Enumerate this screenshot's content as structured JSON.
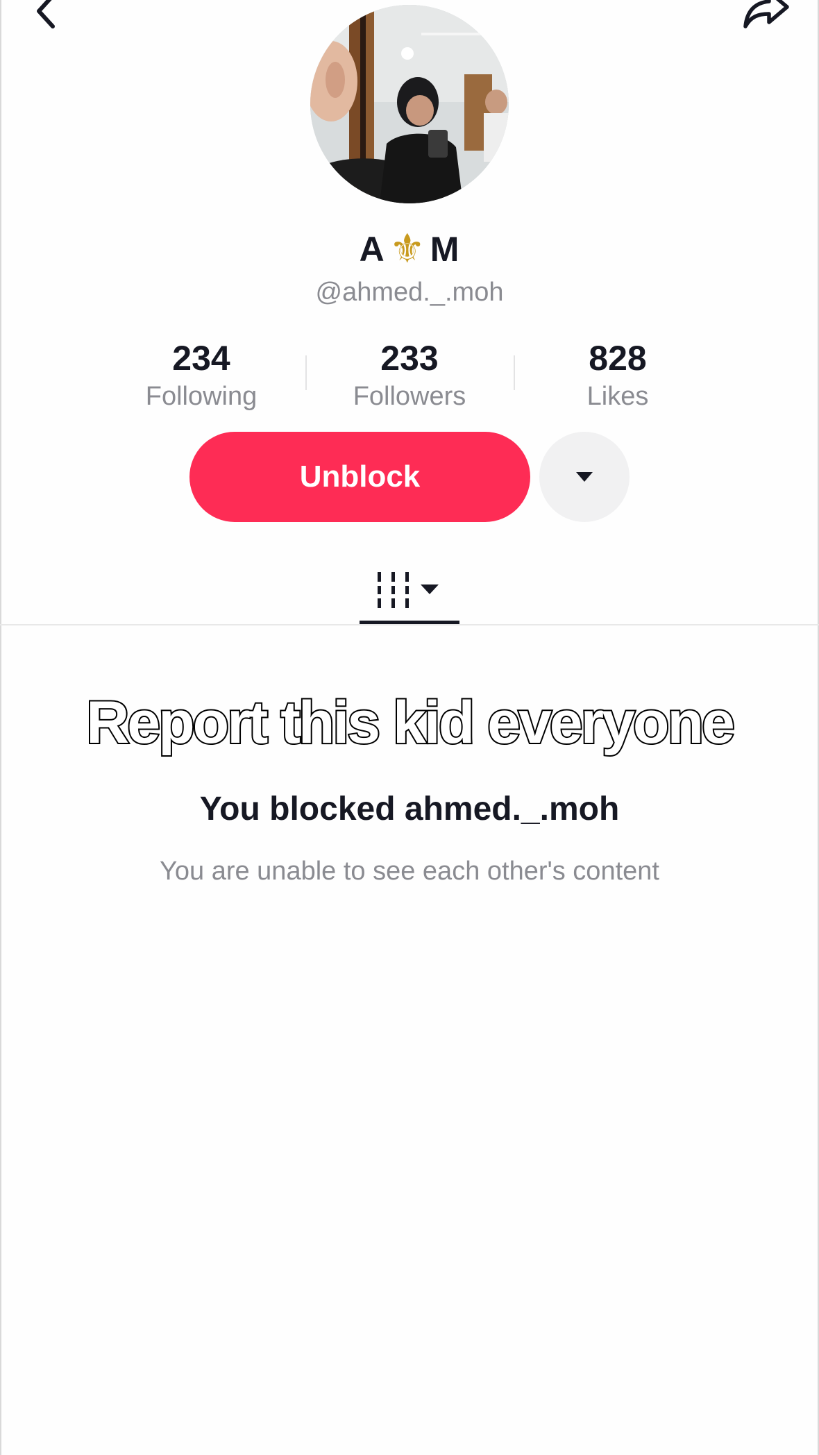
{
  "profile": {
    "name_left": "A",
    "name_symbol": "⚜",
    "name_right": "M",
    "username": "@ahmed._.moh"
  },
  "stats": [
    {
      "value": "234",
      "label": "Following"
    },
    {
      "value": "233",
      "label": "Followers"
    },
    {
      "value": "828",
      "label": "Likes"
    }
  ],
  "actions": {
    "unblock_label": "Unblock"
  },
  "overlay": {
    "caption": "Report this kid everyone"
  },
  "blocked": {
    "title": "You blocked ahmed._.moh",
    "subtitle": "You are unable to see each other's content"
  },
  "colors": {
    "accent": "#fe2c55",
    "text_primary": "#161823",
    "text_secondary": "#8a8b91"
  },
  "icons": {
    "back": "chevron-left-icon",
    "share": "share-arrow-icon",
    "more": "caret-down-icon",
    "tab": "videos-grid-icon"
  }
}
